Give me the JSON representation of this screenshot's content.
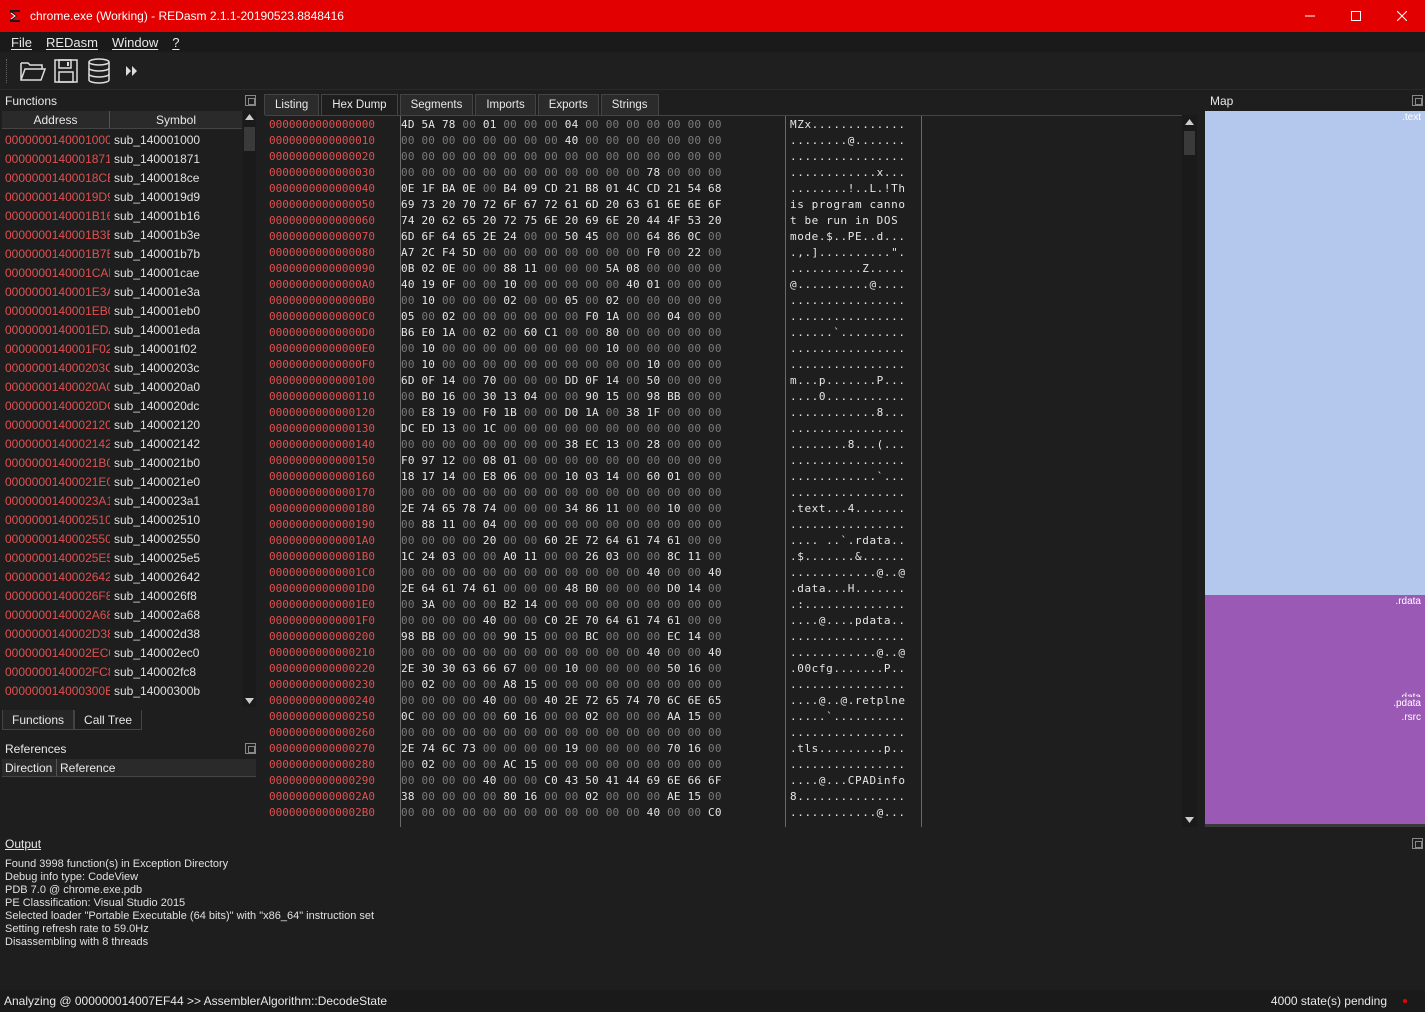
{
  "window": {
    "title": "chrome.exe (Working) - REDasm 2.1.1-20190523.8848416"
  },
  "menu": [
    "File",
    "REDasm",
    "Window",
    "?"
  ],
  "toolbar": {
    "icons": [
      "open-folder-icon",
      "save-icon",
      "database-icon",
      "fast-forward-icon"
    ]
  },
  "functions": {
    "title": "Functions",
    "columns": [
      "Address",
      "Symbol"
    ],
    "rows": [
      [
        "0000000140001000",
        "sub_140001000"
      ],
      [
        "0000000140001871",
        "sub_140001871"
      ],
      [
        "00000001400018CE",
        "sub_1400018ce"
      ],
      [
        "00000001400019D9",
        "sub_1400019d9"
      ],
      [
        "0000000140001B16",
        "sub_140001b16"
      ],
      [
        "0000000140001B3E",
        "sub_140001b3e"
      ],
      [
        "0000000140001B7B",
        "sub_140001b7b"
      ],
      [
        "0000000140001CAE",
        "sub_140001cae"
      ],
      [
        "0000000140001E3A",
        "sub_140001e3a"
      ],
      [
        "0000000140001EB0",
        "sub_140001eb0"
      ],
      [
        "0000000140001EDA",
        "sub_140001eda"
      ],
      [
        "0000000140001F02",
        "sub_140001f02"
      ],
      [
        "000000014000203C",
        "sub_14000203c"
      ],
      [
        "00000001400020A0",
        "sub_1400020a0"
      ],
      [
        "00000001400020DC",
        "sub_1400020dc"
      ],
      [
        "0000000140002120",
        "sub_140002120"
      ],
      [
        "0000000140002142",
        "sub_140002142"
      ],
      [
        "00000001400021B0",
        "sub_1400021b0"
      ],
      [
        "00000001400021E0",
        "sub_1400021e0"
      ],
      [
        "00000001400023A1",
        "sub_1400023a1"
      ],
      [
        "0000000140002510",
        "sub_140002510"
      ],
      [
        "0000000140002550",
        "sub_140002550"
      ],
      [
        "00000001400025E5",
        "sub_1400025e5"
      ],
      [
        "0000000140002642",
        "sub_140002642"
      ],
      [
        "00000001400026F8",
        "sub_1400026f8"
      ],
      [
        "0000000140002A68",
        "sub_140002a68"
      ],
      [
        "0000000140002D38",
        "sub_140002d38"
      ],
      [
        "0000000140002EC0",
        "sub_140002ec0"
      ],
      [
        "0000000140002FC8",
        "sub_140002fc8"
      ],
      [
        "000000014000300B",
        "sub_14000300b"
      ]
    ],
    "tabs": [
      "Functions",
      "Call Tree"
    ]
  },
  "references": {
    "title": "References",
    "columns": [
      "Direction",
      "Reference"
    ]
  },
  "tabs": [
    "Listing",
    "Hex Dump",
    "Segments",
    "Imports",
    "Exports",
    "Strings"
  ],
  "active_tab": "Hex Dump",
  "hex": [
    [
      "0000000000000000",
      "4D 5A 78 00 01 00 00 00 04 00 00 00 00 00 00 00",
      "MZx............."
    ],
    [
      "0000000000000010",
      "00 00 00 00 00 00 00 00 40 00 00 00 00 00 00 00",
      "........@......."
    ],
    [
      "0000000000000020",
      "00 00 00 00 00 00 00 00 00 00 00 00 00 00 00 00",
      "................"
    ],
    [
      "0000000000000030",
      "00 00 00 00 00 00 00 00 00 00 00 00 78 00 00 00",
      "............x..."
    ],
    [
      "0000000000000040",
      "0E 1F BA 0E 00 B4 09 CD 21 B8 01 4C CD 21 54 68",
      "........!..L.!Th"
    ],
    [
      "0000000000000050",
      "69 73 20 70 72 6F 67 72 61 6D 20 63 61 6E 6E 6F",
      "is program canno"
    ],
    [
      "0000000000000060",
      "74 20 62 65 20 72 75 6E 20 69 6E 20 44 4F 53 20",
      "t be run in DOS "
    ],
    [
      "0000000000000070",
      "6D 6F 64 65 2E 24 00 00 50 45 00 00 64 86 0C 00",
      "mode.$..PE..d..."
    ],
    [
      "0000000000000080",
      "A7 2C F4 5D 00 00 00 00 00 00 00 00 F0 00 22 00",
      ".,.]..........\"."
    ],
    [
      "0000000000000090",
      "0B 02 0E 00 00 88 11 00 00 00 5A 08 00 00 00 00",
      "..........Z....."
    ],
    [
      "00000000000000A0",
      "40 19 0F 00 00 10 00 00 00 00 00 40 01 00 00 00",
      "@..........@...."
    ],
    [
      "00000000000000B0",
      "00 10 00 00 00 02 00 00 05 00 02 00 00 00 00 00",
      "................"
    ],
    [
      "00000000000000C0",
      "05 00 02 00 00 00 00 00 00 F0 1A 00 00 04 00 00",
      "................"
    ],
    [
      "00000000000000D0",
      "B6 E0 1A 00 02 00 60 C1 00 00 80 00 00 00 00 00",
      "......`........."
    ],
    [
      "00000000000000E0",
      "00 10 00 00 00 00 00 00 00 00 10 00 00 00 00 00",
      "................"
    ],
    [
      "00000000000000F0",
      "00 10 00 00 00 00 00 00 00 00 00 00 10 00 00 00",
      "................"
    ],
    [
      "0000000000000100",
      "6D 0F 14 00 70 00 00 00 DD 0F 14 00 50 00 00 00",
      "m...p.......P..."
    ],
    [
      "0000000000000110",
      "00 B0 16 00 30 13 04 00 00 90 15 00 98 BB 00 00",
      "....0..........."
    ],
    [
      "0000000000000120",
      "00 E8 19 00 F0 1B 00 00 D0 1A 00 38 1F 00 00 00",
      "............8..."
    ],
    [
      "0000000000000130",
      "DC ED 13 00 1C 00 00 00 00 00 00 00 00 00 00 00",
      "................"
    ],
    [
      "0000000000000140",
      "00 00 00 00 00 00 00 00 38 EC 13 00 28 00 00 00",
      "........8...(..."
    ],
    [
      "0000000000000150",
      "F0 97 12 00 08 01 00 00 00 00 00 00 00 00 00 00",
      "................"
    ],
    [
      "0000000000000160",
      "18 17 14 00 E8 06 00 00 10 03 14 00 60 01 00 00",
      "............`..."
    ],
    [
      "0000000000000170",
      "00 00 00 00 00 00 00 00 00 00 00 00 00 00 00 00",
      "................"
    ],
    [
      "0000000000000180",
      "2E 74 65 78 74 00 00 00 34 86 11 00 00 10 00 00",
      ".text...4......."
    ],
    [
      "0000000000000190",
      "00 88 11 00 04 00 00 00 00 00 00 00 00 00 00 00",
      "................"
    ],
    [
      "00000000000001A0",
      "00 00 00 00 20 00 00 60 2E 72 64 61 74 61 00 00",
      ".... ..`.rdata.."
    ],
    [
      "00000000000001B0",
      "1C 24 03 00 00 A0 11 00 00 26 03 00 00 8C 11 00",
      ".$.......&......"
    ],
    [
      "00000000000001C0",
      "00 00 00 00 00 00 00 00 00 00 00 00 40 00 00 40",
      "............@..@"
    ],
    [
      "00000000000001D0",
      "2E 64 61 74 61 00 00 00 48 B0 00 00 00 D0 14 00",
      ".data...H......."
    ],
    [
      "00000000000001E0",
      "00 3A 00 00 00 B2 14 00 00 00 00 00 00 00 00 00",
      ".:.............."
    ],
    [
      "00000000000001F0",
      "00 00 00 00 40 00 00 C0 2E 70 64 61 74 61 00 00",
      "....@....pdata.."
    ],
    [
      "0000000000000200",
      "98 BB 00 00 00 90 15 00 00 BC 00 00 00 EC 14 00",
      "................"
    ],
    [
      "0000000000000210",
      "00 00 00 00 00 00 00 00 00 00 00 00 40 00 00 40",
      "............@..@"
    ],
    [
      "0000000000000220",
      "2E 30 30 63 66 67 00 00 10 00 00 00 00 50 16 00",
      ".00cfg.......P.."
    ],
    [
      "0000000000000230",
      "00 02 00 00 00 A8 15 00 00 00 00 00 00 00 00 00",
      "................"
    ],
    [
      "0000000000000240",
      "00 00 00 00 40 00 00 40 2E 72 65 74 70 6C 6E 65",
      "....@..@.retplne"
    ],
    [
      "0000000000000250",
      "0C 00 00 00 00 60 16 00 00 02 00 00 00 AA 15 00",
      ".....`.........."
    ],
    [
      "0000000000000260",
      "00 00 00 00 00 00 00 00 00 00 00 00 00 00 00 00",
      "................"
    ],
    [
      "0000000000000270",
      "2E 74 6C 73 00 00 00 00 19 00 00 00 00 70 16 00",
      ".tls.........p.."
    ],
    [
      "0000000000000280",
      "00 02 00 00 00 AC 15 00 00 00 00 00 00 00 00 00",
      "................"
    ],
    [
      "0000000000000290",
      "00 00 00 00 40 00 00 C0 43 50 41 44 69 6E 66 6F",
      "....@...CPADinfo"
    ],
    [
      "00000000000002A0",
      "38 00 00 00 00 80 16 00 00 02 00 00 00 AE 15 00",
      "8..............."
    ],
    [
      "00000000000002B0",
      "00 00 00 00 00 00 00 00 00 00 00 00 40 00 00 C0",
      "............@..."
    ]
  ],
  "map": {
    "title": "Map",
    "segments": [
      {
        "name": ".text",
        "start": 0.0,
        "end": 0.676,
        "color": "#b4c8ee"
      },
      {
        "name": ".rdata",
        "start": 0.676,
        "end": 0.81,
        "color": "#9b59b6"
      },
      {
        "name": ".data",
        "start": 0.81,
        "end": 0.818,
        "color": "#9b59b6"
      },
      {
        "name": ".pdata",
        "start": 0.818,
        "end": 0.838,
        "color": "#9b59b6"
      },
      {
        "name": ".rsrc",
        "start": 0.838,
        "end": 0.996,
        "color": "#9b59b6"
      }
    ]
  },
  "output": {
    "title": "Output",
    "lines": [
      "Found 3998 function(s) in Exception Directory",
      "Debug info type: CodeView",
      "PDB 7.0 @ chrome.exe.pdb",
      "PE Classification: Visual Studio 2015",
      "Selected loader \"Portable Executable (64 bits)\" with \"x86_64\" instruction set",
      "Setting refresh rate to 59.0Hz",
      "Disassembling with 8 threads"
    ]
  },
  "status": {
    "left": "Analyzing @ 000000014007EF44 >> AssemblerAlgorithm::DecodeState",
    "right": "4000 state(s) pending"
  }
}
